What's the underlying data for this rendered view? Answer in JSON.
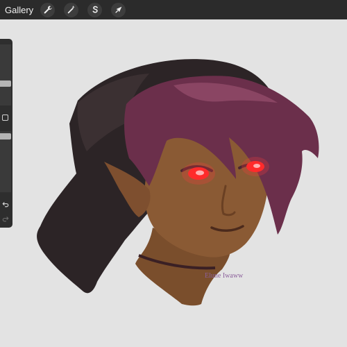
{
  "topbar": {
    "gallery_label": "Gallery",
    "tools": [
      {
        "name": "actions",
        "icon": "wrench-icon"
      },
      {
        "name": "adjustments",
        "icon": "magic-wand-icon"
      },
      {
        "name": "selection",
        "icon": "selection-s-icon"
      },
      {
        "name": "transform",
        "icon": "arrow-cursor-icon"
      }
    ]
  },
  "sidebar": {
    "controls": [
      "brush-size-slider",
      "modify-button",
      "opacity-slider",
      "undo-icon",
      "redo-icon"
    ]
  },
  "canvas": {
    "signature_text": "Elune Iwaww",
    "colors": {
      "background": "#e3e3e3",
      "hood": "#2c2426",
      "hair": "#6b2f4b",
      "skin": "#8a5a34",
      "eyes": "#ff3b3b"
    }
  }
}
